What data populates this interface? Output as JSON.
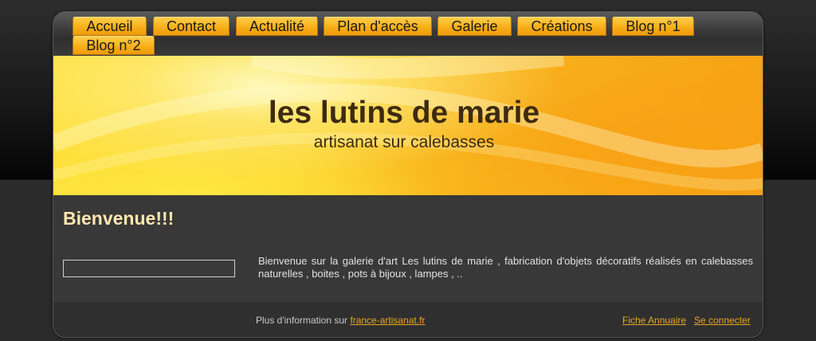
{
  "nav": {
    "items": [
      {
        "label": "Accueil"
      },
      {
        "label": "Contact"
      },
      {
        "label": "Actualité"
      },
      {
        "label": "Plan d'accès"
      },
      {
        "label": "Galerie"
      },
      {
        "label": "Créations"
      },
      {
        "label": "Blog n°1"
      },
      {
        "label": "Blog n°2"
      }
    ]
  },
  "banner": {
    "title": "les lutins de marie",
    "subtitle": "artisanat sur calebasses"
  },
  "main": {
    "heading": "Bienvenue!!!",
    "text": "Bienvenue sur la galerie d'art Les lutins de marie , fabrication d'objets décoratifs réalisés en calebasses naturelles , boites , pots à bijoux , lampes , .."
  },
  "footer": {
    "info_prefix": "Plus d'information sur",
    "info_link": "france-artisanat.fr",
    "annuaire_link": "Fiche Annuaire",
    "login_link": "Se connecter"
  },
  "colors": {
    "accent": "#f7ad16",
    "heading": "#ffe7b0",
    "link": "#e8a623",
    "background": "#383838"
  }
}
